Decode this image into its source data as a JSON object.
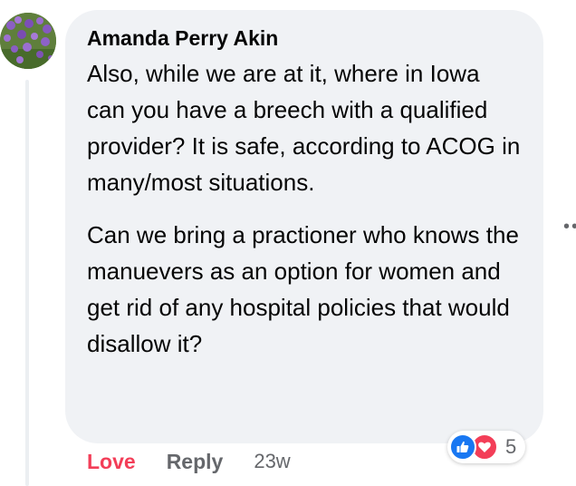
{
  "comment": {
    "author": "Amanda Perry Akin",
    "paragraphs": [
      "Also, while we are at it, where in Iowa can you have a breech with a qualified provider? It is safe, according to ACOG in many/most situations.",
      "Can we bring a practioner who knows the manuevers as an option for women and get rid of any hospital policies that would disallow it?"
    ],
    "avatar_icon": "purple-flowers-avatar"
  },
  "actions": {
    "love_label": "Love",
    "reply_label": "Reply",
    "timestamp": "23w"
  },
  "reactions": {
    "icons": [
      "like-icon",
      "love-icon"
    ],
    "count": "5"
  },
  "more_icon": "more-options-icon",
  "colors": {
    "bubble_bg": "#f0f2f5",
    "love_red": "#f33e58",
    "like_blue": "#1877f2",
    "secondary_text": "#65676b"
  }
}
